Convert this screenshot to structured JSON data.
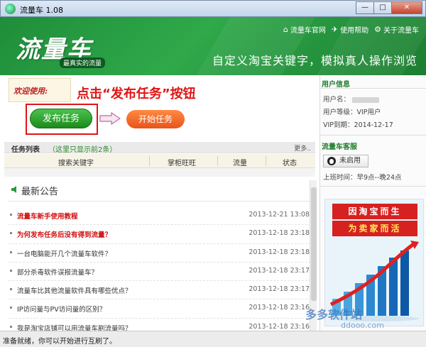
{
  "window": {
    "title": "流量车 1.08",
    "buttons": [
      "—",
      "□",
      "✕"
    ]
  },
  "header": {
    "logo": "流量车",
    "logo_tagline": "最真实的流量",
    "links": [
      {
        "icon": "home-icon",
        "label": "流量车官网"
      },
      {
        "icon": "send-icon",
        "label": "使用帮助"
      },
      {
        "icon": "gear-icon",
        "label": "关于流量车"
      }
    ],
    "slogan": "自定义淘宝关键字，模拟真人操作浏览"
  },
  "main": {
    "welcome": "欢迎使用:",
    "instruction": "点击“发布任务”按钮",
    "publish_button": "发布任务",
    "start_button": "开始任务",
    "task_list": {
      "title": "任务列表",
      "note": "（这里只显示前2条）",
      "more": "更多..",
      "columns": [
        "搜索关键字",
        "掌柜旺旺",
        "流量",
        "状态"
      ]
    },
    "notice_title": "最新公告",
    "news": [
      {
        "title": "流量车新手使用教程",
        "date": "2013-12-21 13:08",
        "hot": true
      },
      {
        "title": "为何发布任务后没有得到流量？",
        "date": "2013-12-18 23:18",
        "hot": true
      },
      {
        "title": "一台电脑能开几个流量车软件？",
        "date": "2013-12-18 23:18",
        "hot": false
      },
      {
        "title": "部分杀毒软件误报流量车？",
        "date": "2013-12-18 23:17",
        "hot": false
      },
      {
        "title": "流量车比其他流量软件具有哪些优点？",
        "date": "2013-12-18 23:17",
        "hot": false
      },
      {
        "title": "IP访问量与PV访问量的区别？",
        "date": "2013-12-18 23:16",
        "hot": false
      },
      {
        "title": "我是淘宝店铺可以用流量车刷流量吗？",
        "date": "2013-12-18 23:16",
        "hot": false
      }
    ]
  },
  "sidebar": {
    "user_info_title": "用户信息",
    "username_label": "用户名：",
    "level": "用户等级：VIP用户",
    "vip_expire": "VIP到期：2014-12-17",
    "service_title": "流量车客服",
    "service_button": "未启用",
    "hours": "上班时间：早9点--晚24点",
    "ad_line1": "因淘宝而生",
    "ad_line2": "为卖家而活"
  },
  "watermark": {
    "brand": "多多软件站",
    "url": "ddooo.com"
  },
  "status": "准备就绪，你可以开始进行互刷了。",
  "colors": {
    "header_green": "#2fa94a",
    "alert_red": "#e01414",
    "publish_green": "#1b8a1b",
    "start_orange": "#e8531a"
  }
}
